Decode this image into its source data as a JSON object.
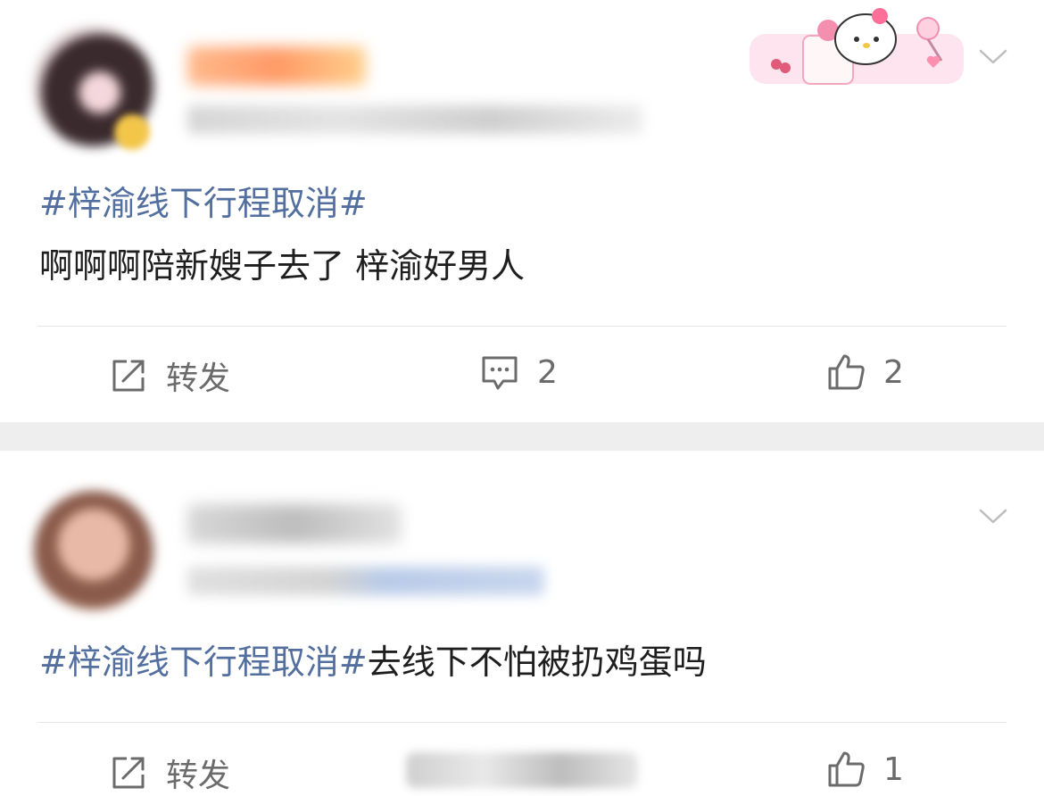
{
  "posts": [
    {
      "hashtag": "#梓渝线下行程取消#",
      "content": "啊啊啊陪新嫂子去了 梓渝好男人",
      "actions": {
        "repost_label": "转发",
        "comment_count": "2",
        "like_count": "2"
      },
      "icons": [
        "avatar",
        "verified-badge",
        "chevron-down-icon",
        "hello-kitty-sticker",
        "repost-icon",
        "comment-icon",
        "like-icon"
      ]
    },
    {
      "hashtag": "#梓渝线下行程取消#",
      "content": "去线下不怕被扔鸡蛋吗",
      "actions": {
        "repost_label": "转发",
        "like_count": "1"
      },
      "icons": [
        "avatar",
        "chevron-down-icon",
        "repost-icon",
        "like-icon"
      ]
    }
  ],
  "colors": {
    "hashtag": "#536fa0",
    "text": "#1e1e1e",
    "action": "#6b6b6b",
    "separator": "#eeeeee"
  }
}
